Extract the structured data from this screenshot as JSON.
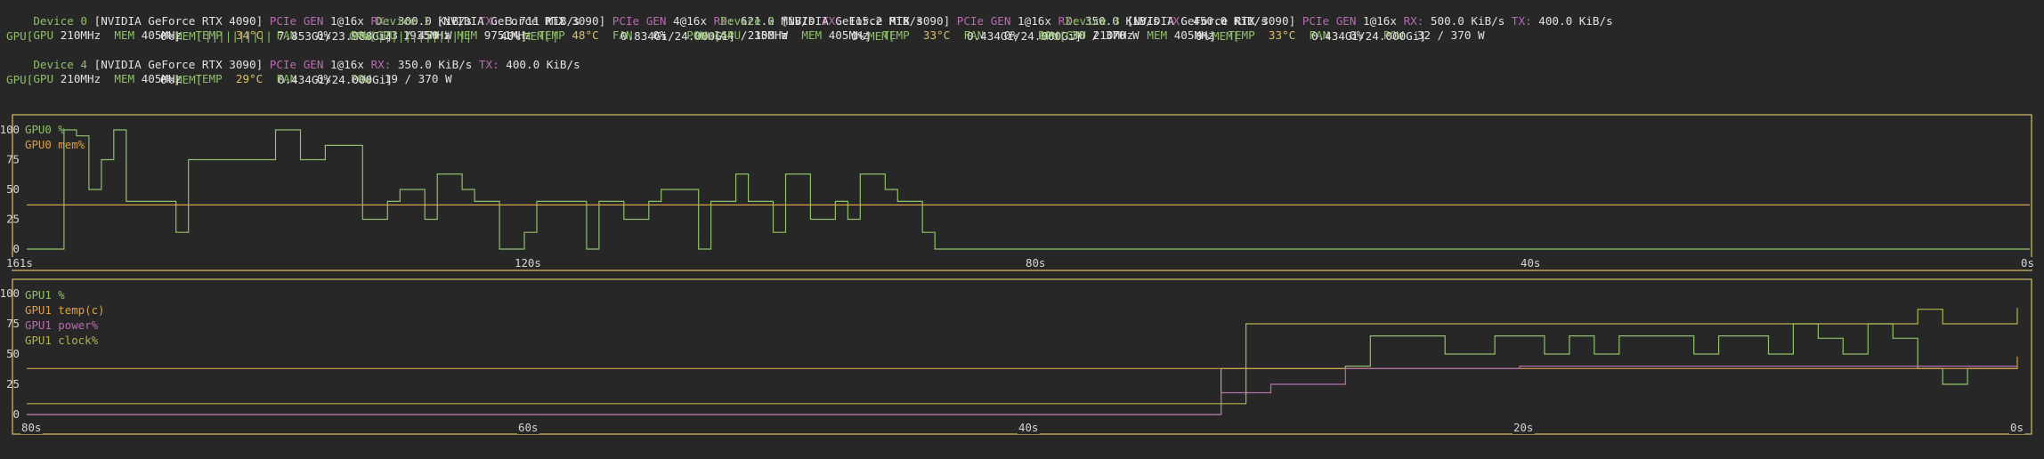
{
  "devices": [
    {
      "id": "Device 0",
      "name": "[NVIDIA GeForce RTX 4090]",
      "pcie_label": "PCIe",
      "gen_label": "GEN",
      "gen": "1@16x",
      "rx_label": "RX:",
      "rx": "300.0 KiB/s",
      "tx_label": "TX:",
      "tx": "3.711 MiB/s",
      "gpu_label": "GPU",
      "gpu_clock": "210MHz",
      "mem_label": "MEM",
      "mem_clock": "405MHz",
      "temp_label": "TEMP",
      "temp": "34°C",
      "fan_label": "FAN",
      "fan": "0%",
      "pow_label": "POW",
      "pow": "23 / 450 W",
      "gpu_bar_label": "GPU[",
      "gpu_util": "0%]",
      "mem_bar_label": "MEM[",
      "mem_bar_fill": "||||||||||",
      "mem_usage": "7.853Gi/23.988Gi]"
    },
    {
      "id": "Device 1",
      "name": "[NVIDIA GeForce RTX 3090]",
      "pcie_label": "PCIe",
      "gen_label": "GEN",
      "gen": "4@16x",
      "rx_label": "RX:",
      "rx": "621.0 MiB/s",
      "tx_label": "TX:",
      "tx": "115.2 MiB/s",
      "gpu_label": "GPU",
      "gpu_clock": "1935MHz",
      "mem_label": "MEM",
      "mem_clock": "9751MHz",
      "temp_label": "TEMP",
      "temp": "48°C",
      "fan_label": "FAN",
      "fan": "0%",
      "pow_label": "POW",
      "pow": "144 / 350 W",
      "gpu_bar_label": "GPU[",
      "gpu_bar_fill": "||||||||||||||",
      "gpu_util": "40%]",
      "mem_bar_label": "MEM[",
      "mem_bar_fill": "|",
      "mem_usage": "0.834Gi/24.000Gi]"
    },
    {
      "id": "Device 2",
      "name": "[NVIDIA GeForce RTX 3090]",
      "pcie_label": "PCIe",
      "gen_label": "GEN",
      "gen": "1@16x",
      "rx_label": "RX:",
      "rx": "350.0 KiB/s",
      "tx_label": "TX:",
      "tx": "450.0 KiB/s",
      "gpu_label": "GPU",
      "gpu_clock": "210MHz",
      "mem_label": "MEM",
      "mem_clock": "405MHz",
      "temp_label": "TEMP",
      "temp": "33°C",
      "fan_label": "FAN",
      "fan": "0%",
      "pow_label": "POW",
      "pow": "30 / 370 W",
      "gpu_bar_label": "GPU[",
      "gpu_util": "0%]",
      "mem_bar_label": "MEM[",
      "mem_usage": "0.434Gi/24.000Gi]"
    },
    {
      "id": "Device 3",
      "name": "[NVIDIA GeForce RTX 3090]",
      "pcie_label": "PCIe",
      "gen_label": "GEN",
      "gen": "1@16x",
      "rx_label": "RX:",
      "rx": "500.0 KiB/s",
      "tx_label": "TX:",
      "tx": "400.0 KiB/s",
      "gpu_label": "GPU",
      "gpu_clock": "210MHz",
      "mem_label": "MEM",
      "mem_clock": "405MHz",
      "temp_label": "TEMP",
      "temp": "33°C",
      "fan_label": "FAN",
      "fan": "0%",
      "pow_label": "POW",
      "pow": "32 / 370 W",
      "gpu_bar_label": "GPU[",
      "gpu_util": "0%]",
      "mem_bar_label": "MEM[",
      "mem_usage": "0.434Gi/24.000Gi]"
    },
    {
      "id": "Device 4",
      "name": "[NVIDIA GeForce RTX 3090]",
      "pcie_label": "PCIe",
      "gen_label": "GEN",
      "gen": "1@16x",
      "rx_label": "RX:",
      "rx": "350.0 KiB/s",
      "tx_label": "TX:",
      "tx": "400.0 KiB/s",
      "gpu_label": "GPU",
      "gpu_clock": "210MHz",
      "mem_label": "MEM",
      "mem_clock": "405MHz",
      "temp_label": "TEMP",
      "temp": "29°C",
      "fan_label": "FAN",
      "fan": "0%",
      "pow_label": "POW",
      "pow": "19 / 370 W",
      "gpu_bar_label": "GPU[",
      "gpu_util": "0%]",
      "mem_bar_label": "MEM[",
      "mem_usage": "0.434Gi/24.000Gi]"
    }
  ],
  "colors": {
    "background": "#272727",
    "frame": "#d8c069",
    "util": "#8fbf6a",
    "mem": "#d8a04a",
    "temp": "#d8a04a",
    "power": "#b76bb0",
    "clock": "#b4b24a",
    "text": "#d6d6d6"
  },
  "chart_data": [
    {
      "type": "line",
      "ylim": [
        0,
        100
      ],
      "yticks": [
        "100",
        "75",
        "50",
        "25",
        "0"
      ],
      "x_tick_labels": [
        "161s",
        "120s",
        "80s",
        "40s",
        "0s"
      ],
      "x_ticks_seconds_ago": [
        161,
        120,
        80,
        40,
        0
      ],
      "xlim_seconds_ago": [
        161,
        0
      ],
      "series": [
        {
          "name": "GPU0 %",
          "color": "#8fbf6a",
          "x_seconds_ago": [
            161,
            158,
            157,
            156,
            155,
            154,
            153,
            152,
            151,
            149,
            148,
            146,
            145,
            144,
            142,
            141,
            139,
            137,
            134,
            132,
            131,
            129,
            128,
            126,
            125,
            123,
            121,
            120,
            118,
            116,
            115,
            113,
            111,
            110,
            109,
            107,
            106,
            104,
            103,
            101,
            100,
            98,
            96,
            95,
            94,
            92,
            91,
            89,
            88,
            86,
            85,
            84,
            0
          ],
          "values": [
            0,
            100,
            95,
            50,
            75,
            100,
            40,
            40,
            40,
            14,
            75,
            75,
            75,
            75,
            75,
            100,
            75,
            87,
            25,
            40,
            50,
            25,
            63,
            50,
            40,
            0,
            14,
            40,
            40,
            0,
            40,
            25,
            40,
            50,
            50,
            0,
            40,
            63,
            40,
            14,
            63,
            25,
            40,
            25,
            63,
            50,
            40,
            14,
            0,
            0,
            0,
            0,
            0
          ]
        },
        {
          "name": "GPU0 mem%",
          "color": "#d8a04a",
          "x_seconds_ago": [
            161,
            0
          ],
          "values": [
            37,
            37
          ]
        }
      ]
    },
    {
      "type": "line",
      "ylim": [
        0,
        100
      ],
      "yticks": [
        "100",
        "75",
        "50",
        "25",
        "0"
      ],
      "x_tick_labels": [
        "80s",
        "60s",
        "40s",
        "20s",
        "0s"
      ],
      "x_ticks_seconds_ago": [
        80,
        60,
        40,
        20,
        0
      ],
      "xlim_seconds_ago": [
        80,
        0
      ],
      "series": [
        {
          "name": "GPU1 %",
          "color": "#8fbf6a",
          "x_seconds_ago": [
            80,
            33,
            32,
            31,
            29,
            28,
            27,
            26,
            24,
            23,
            22,
            21,
            20,
            19,
            18,
            17,
            16,
            15,
            13,
            12,
            11,
            10,
            9,
            8,
            7,
            6,
            5,
            4,
            3,
            2,
            1,
            0
          ],
          "values": [
            0,
            0,
            38,
            38,
            38,
            38,
            40,
            65,
            65,
            50,
            50,
            65,
            65,
            50,
            65,
            50,
            65,
            65,
            50,
            65,
            65,
            50,
            75,
            63,
            50,
            75,
            63,
            38,
            25,
            38,
            38,
            38
          ]
        },
        {
          "name": "GPU1 temp(c)",
          "color": "#d8a04a",
          "x_seconds_ago": [
            80,
            20,
            0
          ],
          "values": [
            38,
            38,
            48
          ]
        },
        {
          "name": "GPU1 power%",
          "color": "#b76bb0",
          "x_seconds_ago": [
            80,
            32.5,
            32,
            30,
            27,
            20,
            0
          ],
          "values": [
            0,
            0,
            18,
            25,
            38,
            40,
            40
          ]
        },
        {
          "name": "GPU1 clock%",
          "color": "#b4b24a",
          "x_seconds_ago": [
            80,
            32,
            31,
            29,
            4,
            3,
            1,
            0
          ],
          "values": [
            9,
            9,
            75,
            75,
            87,
            75,
            75,
            88
          ]
        }
      ]
    }
  ]
}
